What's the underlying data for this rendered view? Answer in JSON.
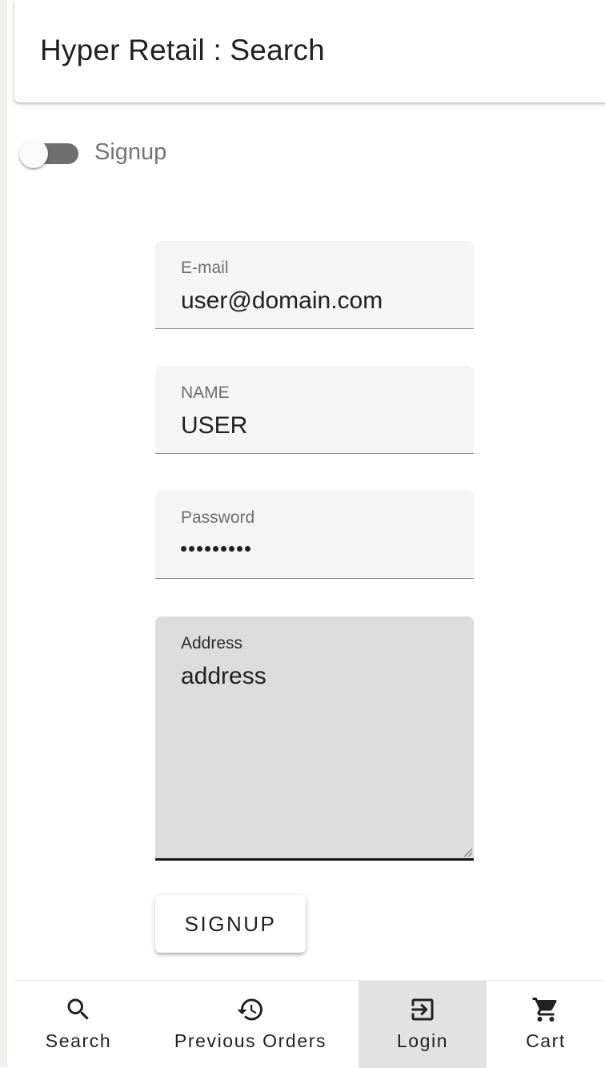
{
  "app_bar": {
    "title": "Hyper Retail : Search"
  },
  "signup_toggle": {
    "label": "Signup",
    "checked": false
  },
  "form": {
    "email": {
      "label": "E-mail",
      "value": "user@domain.com"
    },
    "name": {
      "label": "NAME",
      "value": "USER"
    },
    "password": {
      "label": "Password",
      "masked_length": 9
    },
    "address": {
      "label": "Address",
      "value": "address"
    },
    "submit_label": "SIGNUP"
  },
  "bottom_nav": {
    "items": [
      {
        "label": "Search",
        "icon": "search-icon"
      },
      {
        "label": "Previous Orders",
        "icon": "history-icon"
      },
      {
        "label": "Login",
        "icon": "login-icon",
        "active": true
      },
      {
        "label": "Cart",
        "icon": "cart-icon"
      }
    ]
  },
  "colors": {
    "active_nav_bg": "#e2e2e2",
    "field_bg": "#f5f5f5",
    "focused_field_bg": "#dcdcdc",
    "toggle_track": "#6f6f6f"
  }
}
